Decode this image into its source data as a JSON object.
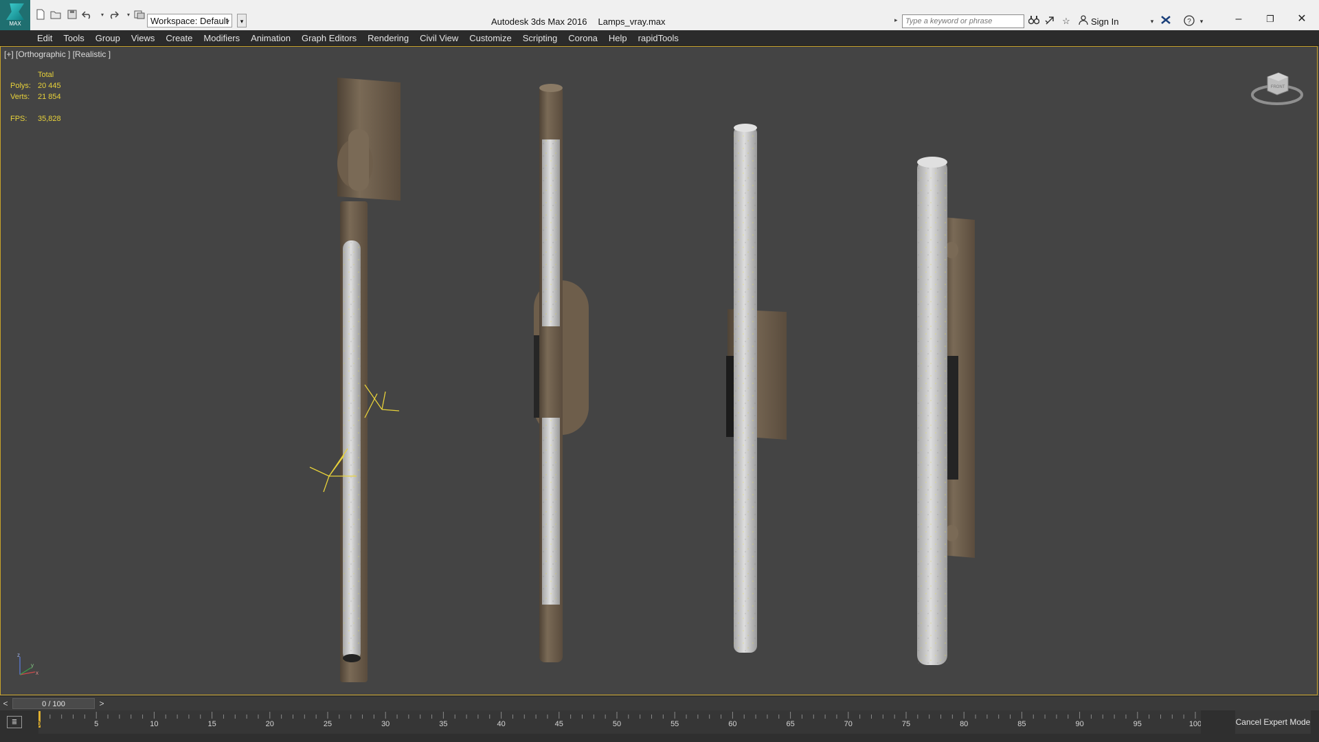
{
  "titlebar": {
    "logo_text": "MAX",
    "workspace_label": "Workspace: Default",
    "app_name": "Autodesk 3ds Max 2016",
    "file_name": "Lamps_vray.max",
    "search_placeholder": "Type a keyword or phrase",
    "signin_label": "Sign In",
    "icons": [
      "new-icon",
      "open-icon",
      "save-icon",
      "undo-icon",
      "redo-icon",
      "project-folder-icon",
      "binoculars-icon",
      "exchange-icon",
      "star-icon",
      "user-icon",
      "x-exchange-icon",
      "help-icon"
    ]
  },
  "menubar": {
    "items": [
      "Edit",
      "Tools",
      "Group",
      "Views",
      "Create",
      "Modifiers",
      "Animation",
      "Graph Editors",
      "Rendering",
      "Civil View",
      "Customize",
      "Scripting",
      "Corona",
      "Help",
      "rapidTools"
    ]
  },
  "viewport": {
    "label": "[+] [Orthographic ] [Realistic ]",
    "stats": {
      "header": "Total",
      "polys_label": "Polys:",
      "polys_value": "20 445",
      "verts_label": "Verts:",
      "verts_value": "21 854",
      "fps_label": "FPS:",
      "fps_value": "35,828"
    },
    "viewcube_label": "FRONT",
    "axis_labels": [
      "z",
      "x",
      "y"
    ],
    "colors": {
      "background": "#444444",
      "border": "#c9a42a",
      "stats": "#e8d23a",
      "wood": "#6e5e4b",
      "glass": "#c9c9c9"
    }
  },
  "timeline": {
    "frame_label": "0 / 100",
    "prev_label": "<",
    "next_label": ">",
    "ticks": [
      "0",
      "5",
      "10",
      "15",
      "20",
      "25",
      "30",
      "35",
      "40",
      "45",
      "50",
      "55",
      "60",
      "65",
      "70",
      "75",
      "80",
      "85",
      "90",
      "95",
      "100"
    ],
    "cancel_expert_label": "Cancel Expert Mode"
  }
}
